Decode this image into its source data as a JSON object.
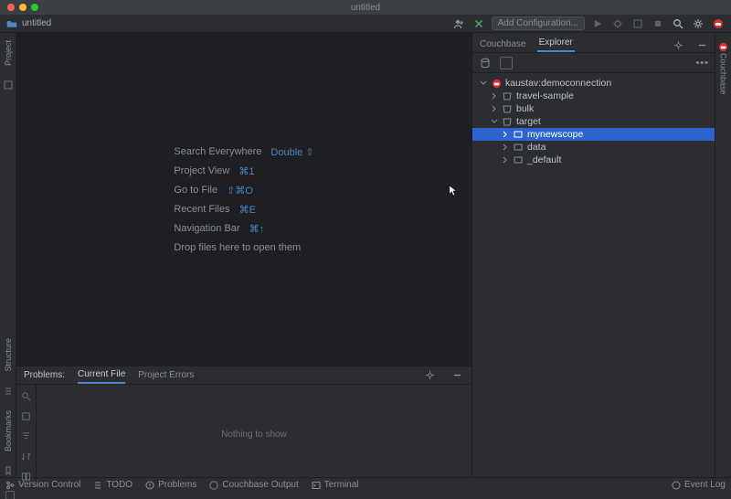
{
  "titlebar": {
    "title": "untitled"
  },
  "nav": {
    "breadcrumb": "untitled",
    "add_config": "Add Configuration..."
  },
  "left_gutter": {
    "project": "Project",
    "structure": "Structure",
    "bookmarks": "Bookmarks"
  },
  "right_gutter": {
    "couchbase": "Couchbase"
  },
  "hints": {
    "rows": [
      {
        "label": "Search Everywhere",
        "key": "Double ⇧"
      },
      {
        "label": "Project View",
        "key": "⌘1"
      },
      {
        "label": "Go to File",
        "key": "⇧⌘O"
      },
      {
        "label": "Recent Files",
        "key": "⌘E"
      },
      {
        "label": "Navigation Bar",
        "key": "⌘↑"
      }
    ],
    "drop": "Drop files here to open them"
  },
  "side": {
    "tabs": {
      "couchbase": "Couchbase",
      "explorer": "Explorer"
    },
    "tree": {
      "conn": "kaustav:democonnection",
      "travel": "travel-sample",
      "bulk": "bulk",
      "target": "target",
      "mynewscope": "mynewscope",
      "data": "data",
      "default": "_default"
    }
  },
  "problems": {
    "header": "Problems:",
    "current": "Current File",
    "errors": "Project Errors",
    "empty": "Nothing to show"
  },
  "toolwin": {
    "vc": "Version Control",
    "todo": "TODO",
    "problems": "Problems",
    "cbout": "Couchbase Output",
    "terminal": "Terminal",
    "eventlog": "Event Log"
  }
}
